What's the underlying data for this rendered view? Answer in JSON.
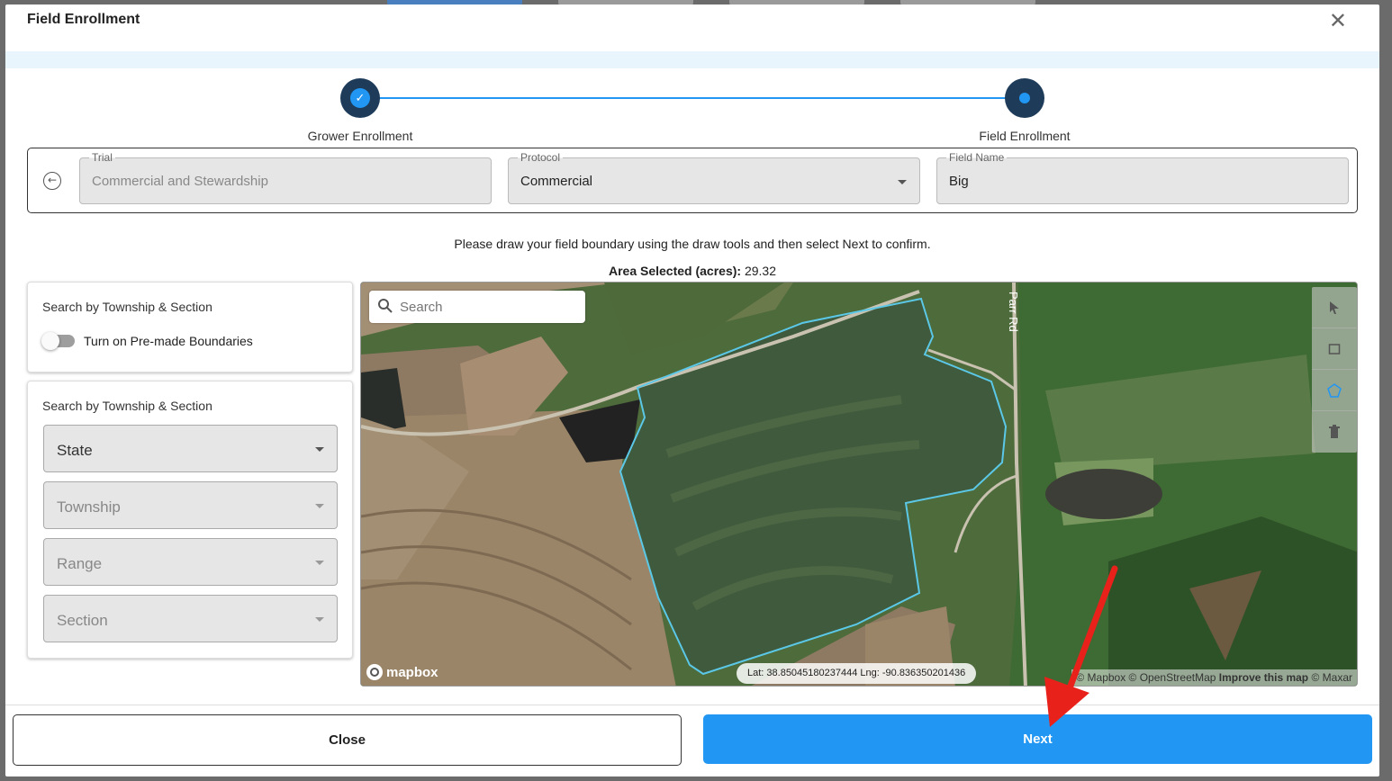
{
  "modal": {
    "title": "Field Enrollment",
    "close_icon": "close-icon"
  },
  "stepper": {
    "steps": [
      {
        "label": "Grower Enrollment",
        "state": "complete"
      },
      {
        "label": "Field Enrollment",
        "state": "active"
      }
    ]
  },
  "fields": {
    "trial": {
      "label": "Trial",
      "value": "Commercial and Stewardship"
    },
    "protocol": {
      "label": "Protocol",
      "value": "Commercial"
    },
    "field_name": {
      "label": "Field Name",
      "value": "Big"
    }
  },
  "instruction": "Please draw your field boundary using the draw tools and then select Next to confirm.",
  "area": {
    "label": "Area Selected (acres):",
    "value": "29.32"
  },
  "panel_premade": {
    "title": "Search by Township & Section",
    "toggle_label": "Turn on Pre-made Boundaries",
    "toggle_on": false
  },
  "panel_township": {
    "title": "Search by Township & Section",
    "selects": [
      {
        "value": "State",
        "disabled": false
      },
      {
        "value": "Township",
        "disabled": true
      },
      {
        "value": "Range",
        "disabled": true
      },
      {
        "value": "Section",
        "disabled": true
      }
    ]
  },
  "map": {
    "search_placeholder": "Search",
    "road_label": "Parr Rd",
    "logo_text": "mapbox",
    "latlng": "Lat: 38.85045180237444 Lng: -90.836350201436",
    "attribution_a": "© Mapbox © OpenStreetMap",
    "attribution_improve": "Improve this map",
    "attribution_b": "© Maxar",
    "tools": [
      "pointer-icon",
      "square-icon",
      "polygon-icon",
      "trash-icon"
    ],
    "boundary_color": "#5bc8e8"
  },
  "footer": {
    "close_label": "Close",
    "next_label": "Next"
  },
  "colors": {
    "accent": "#2196f3",
    "step_dark": "#1e3c5a",
    "annotation_arrow": "#e8221b"
  }
}
